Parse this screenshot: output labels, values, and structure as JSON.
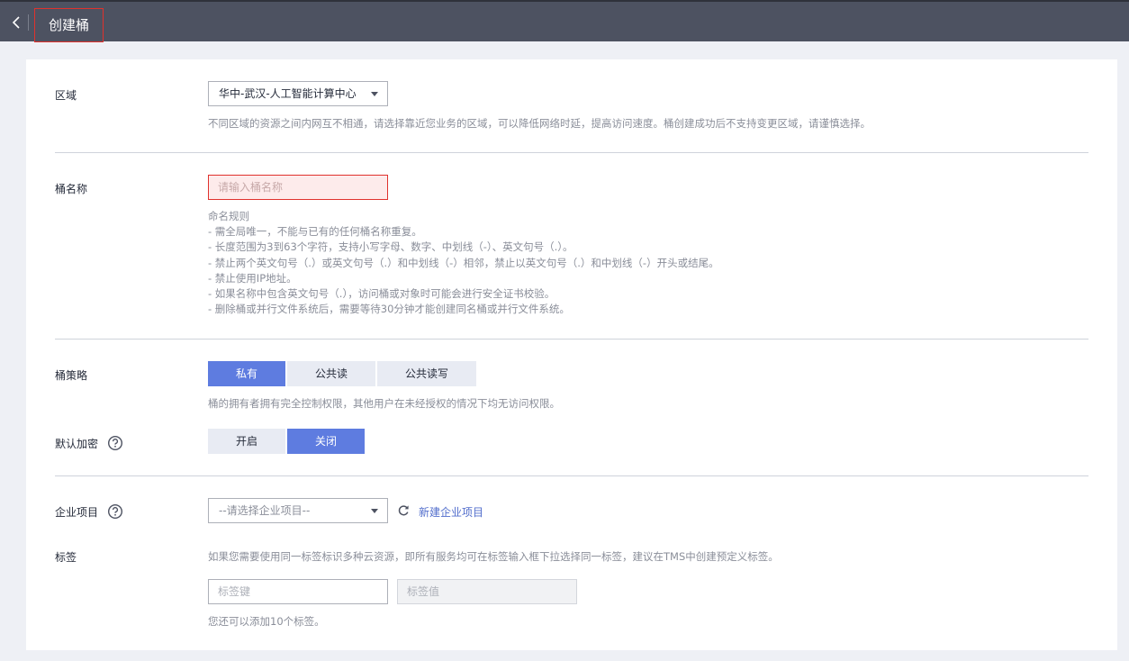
{
  "header": {
    "title": "创建桶"
  },
  "region": {
    "label": "区域",
    "value": "华中-武汉-人工智能计算中心",
    "hint": "不同区域的资源之间内网互不相通，请选择靠近您业务的区域，可以降低网络时延，提高访问速度。桶创建成功后不支持变更区域，请谨慎选择。"
  },
  "bucket_name": {
    "label": "桶名称",
    "placeholder": "请输入桶名称",
    "rules_title": "命名规则",
    "rules": [
      "- 需全局唯一，不能与已有的任何桶名称重复。",
      "- 长度范围为3到63个字符，支持小写字母、数字、中划线（-）、英文句号（.）。",
      "- 禁止两个英文句号（.）或英文句号（.）和中划线（-）相邻，禁止以英文句号（.）和中划线（-）开头或结尾。",
      "- 禁止使用IP地址。",
      "- 如果名称中包含英文句号（.），访问桶或对象时可能会进行安全证书校验。",
      "- 删除桶或并行文件系统后，需要等待30分钟才能创建同名桶或并行文件系统。"
    ]
  },
  "policy": {
    "label": "桶策略",
    "options": [
      "私有",
      "公共读",
      "公共读写"
    ],
    "selected": "私有",
    "hint": "桶的拥有者拥有完全控制权限，其他用户在未经授权的情况下均无访问权限。"
  },
  "encryption": {
    "label": "默认加密",
    "options": [
      "开启",
      "关闭"
    ],
    "selected": "关闭"
  },
  "enterprise_project": {
    "label": "企业项目",
    "placeholder": "--请选择企业项目--",
    "create_link": "新建企业项目"
  },
  "tags": {
    "label": "标签",
    "hint": "如果您需要使用同一标签标识多种云资源，即所有服务均可在标签输入框下拉选择同一标签，建议在TMS中创建预定义标签。",
    "key_placeholder": "标签键",
    "value_placeholder": "标签值",
    "remaining": "您还可以添加10个标签。"
  },
  "colors": {
    "header_bg": "#4d5261",
    "accent": "#5e7ce0",
    "link": "#526ecc",
    "error": "#e0322d"
  },
  "icons": [
    "chevron-left-icon",
    "help-icon",
    "caret-down-icon",
    "refresh-icon"
  ]
}
